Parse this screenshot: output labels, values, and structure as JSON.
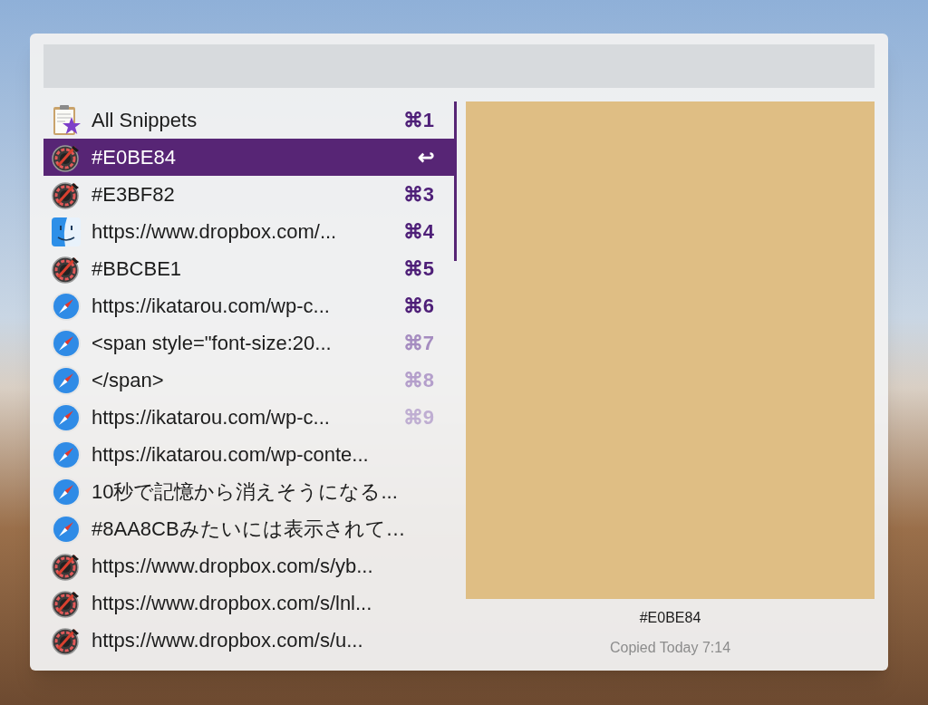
{
  "items": [
    {
      "kind": "snippets",
      "label": "All Snippets",
      "shortcut": "⌘1",
      "color": "#4e1f78",
      "selected": false
    },
    {
      "kind": "palette",
      "label": "#E0BE84",
      "shortcut": "↩",
      "color": "#ffffff",
      "selected": true
    },
    {
      "kind": "palette",
      "label": "#E3BF82",
      "shortcut": "⌘3",
      "color": "#4e1f78",
      "selected": false
    },
    {
      "kind": "finder",
      "label": "https://www.dropbox.com/...",
      "shortcut": "⌘4",
      "color": "#4e1f78",
      "selected": false
    },
    {
      "kind": "palette",
      "label": "#BBCBE1",
      "shortcut": "⌘5",
      "color": "#4e1f78",
      "selected": false
    },
    {
      "kind": "safari",
      "label": "https://ikatarou.com/wp-c...",
      "shortcut": "⌘6",
      "color": "#4e1f78",
      "selected": false
    },
    {
      "kind": "safari",
      "label": "<span style=\"font-size:20...",
      "shortcut": "⌘7",
      "color": "#a58cc0",
      "selected": false
    },
    {
      "kind": "safari",
      "label": "</span>",
      "shortcut": "⌘8",
      "color": "#b49fcb",
      "selected": false
    },
    {
      "kind": "safari",
      "label": "https://ikatarou.com/wp-c...",
      "shortcut": "⌘9",
      "color": "#bfaed2",
      "selected": false
    },
    {
      "kind": "safari",
      "label": "https://ikatarou.com/wp-conte...",
      "selected": false
    },
    {
      "kind": "safari",
      "label": "10秒で記憶から消えそうになる...",
      "selected": false
    },
    {
      "kind": "safari",
      "label": "#8AA8CBみたいには表示されて…",
      "selected": false
    },
    {
      "kind": "palette",
      "label": "https://www.dropbox.com/s/yb...",
      "selected": false
    },
    {
      "kind": "palette",
      "label": "https://www.dropbox.com/s/lnl...",
      "selected": false
    },
    {
      "kind": "palette",
      "label": "https://www.dropbox.com/s/u...",
      "selected": false
    }
  ],
  "preview": {
    "color": "#dfbe84",
    "title": "#E0BE84",
    "caption": "Copied Today 7:14"
  }
}
